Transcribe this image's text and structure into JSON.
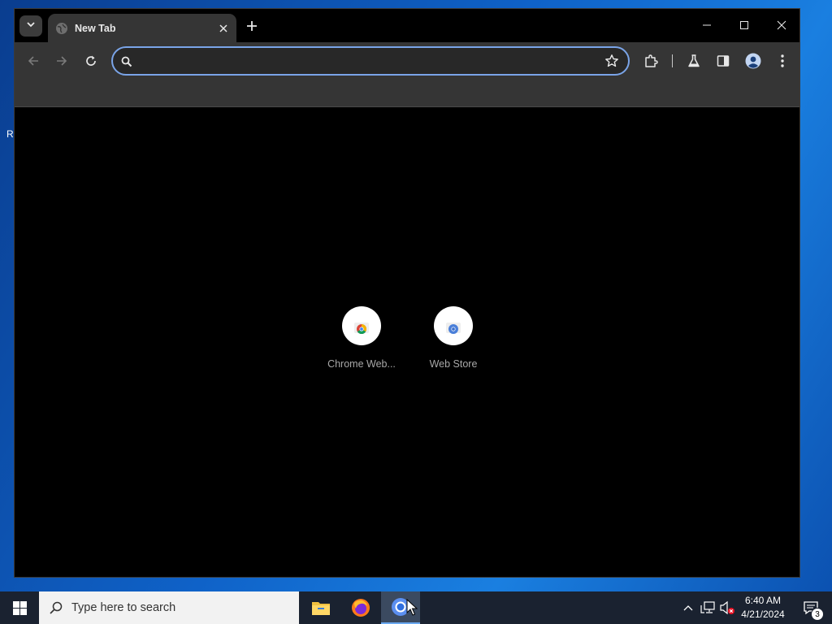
{
  "desktop": {
    "edge_label": "R"
  },
  "browser": {
    "tab": {
      "title": "New Tab"
    },
    "omnibox": {
      "value": "",
      "placeholder": ""
    },
    "shortcuts": [
      {
        "label": "Chrome Web..."
      },
      {
        "label": "Web Store"
      }
    ]
  },
  "taskbar": {
    "search_placeholder": "Type here to search",
    "clock": {
      "time": "6:40 AM",
      "date": "4/21/2024"
    },
    "notification_count": "3"
  },
  "colors": {
    "accent_focus": "#7aa4e8",
    "toolbar_bg": "#353535",
    "page_bg": "#000000",
    "taskbar_bg": "#1a2230"
  },
  "icons": [
    "tab-search-icon",
    "globe-icon",
    "close-icon",
    "plus-icon",
    "minimize-icon",
    "maximize-icon",
    "back-arrow-icon",
    "forward-arrow-icon",
    "reload-icon",
    "search-icon",
    "star-icon",
    "extensions-icon",
    "labs-flask-icon",
    "side-panel-icon",
    "profile-avatar-icon",
    "more-menu-icon",
    "windows-logo-icon",
    "file-explorer-icon",
    "firefox-icon",
    "chrome-icon",
    "chevron-up-icon",
    "network-icon",
    "volume-muted-icon",
    "notification-icon"
  ]
}
